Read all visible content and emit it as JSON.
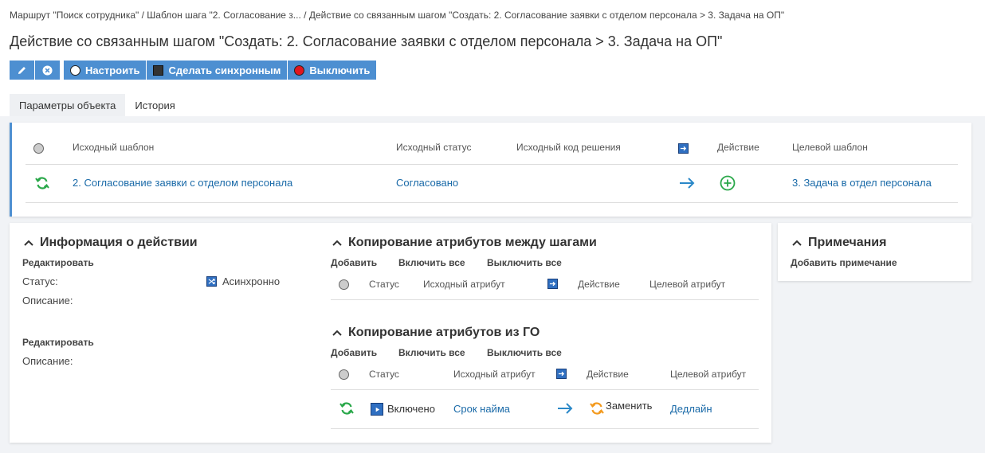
{
  "breadcrumb": {
    "item1": "Маршрут \"Поиск сотрудника\"",
    "sep": " / ",
    "item2": "Шаблон шага \"2. Согласование з...",
    "item3": "Действие со связанным шагом \"Создать: 2. Согласование заявки с отделом персонала > 3. Задача на ОП\""
  },
  "title": "Действие со связанным шагом \"Создать: 2. Согласование заявки с отделом персонала > 3. Задача на ОП\"",
  "toolbar": {
    "edit_icon": "pencil-icon",
    "delete_icon": "close-circle-icon",
    "configure": "Настроить",
    "make_sync": "Сделать синхронным",
    "disable": "Выключить"
  },
  "tabs": [
    "Параметры объекта",
    "История"
  ],
  "transition_table": {
    "headers": {
      "source_template": "Исходный шаблон",
      "source_status": "Исходный статус",
      "source_code": "Исходный код решения",
      "action": "Действие",
      "target_template": "Целевой шаблон"
    },
    "row": {
      "source_template": "2. Согласование заявки с отделом персонала",
      "source_status": "Согласовано",
      "target_template": "3. Задача в отдел персонала"
    }
  },
  "info": {
    "title": "Информация о действии",
    "edit1": "Редактировать",
    "status_label": "Статус:",
    "status_value": "Асинхронно",
    "description_label": "Описание:",
    "edit2": "Редактировать",
    "description_label2": "Описание:"
  },
  "copy_steps": {
    "title": "Копирование атрибутов между шагами",
    "add": "Добавить",
    "enable_all": "Включить все",
    "disable_all": "Выключить все",
    "headers": {
      "status": "Статус",
      "source_attr": "Исходный атрибут",
      "action": "Действие",
      "target_attr": "Целевой атрибут"
    }
  },
  "copy_go": {
    "title": "Копирование атрибутов из ГО",
    "add": "Добавить",
    "enable_all": "Включить все",
    "disable_all": "Выключить все",
    "headers": {
      "status": "Статус",
      "source_attr": "Исходный атрибут",
      "action": "Действие",
      "target_attr": "Целевой атрибут"
    },
    "row": {
      "status": "Включено",
      "source_attr": "Срок найма",
      "action": "Заменить",
      "target_attr": "Дедлайн"
    }
  },
  "notes": {
    "title": "Примечания",
    "add_note": "Добавить примечание"
  },
  "colors": {
    "accent": "#4d8fd1",
    "link": "#1a6aa8",
    "green": "#2aa84a",
    "orange": "#f39a1e"
  }
}
